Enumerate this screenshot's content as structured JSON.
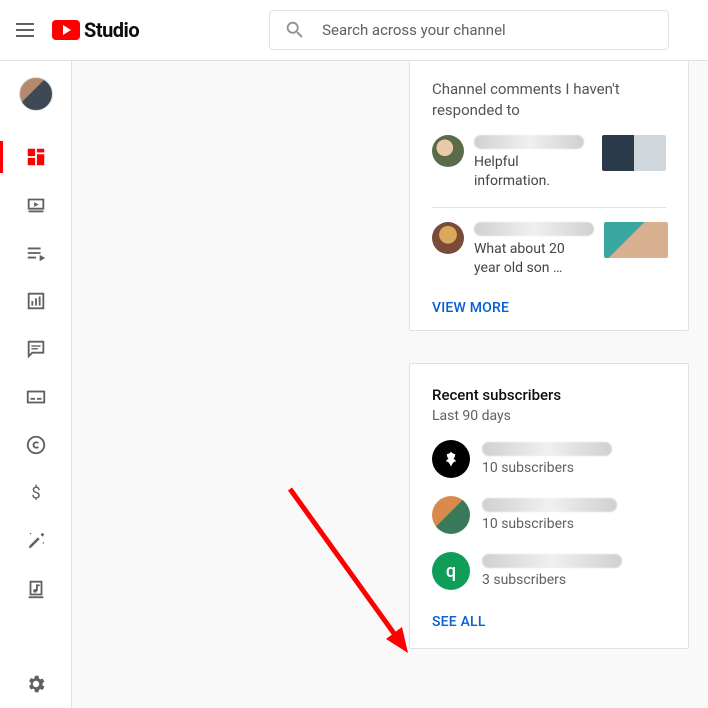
{
  "header": {
    "brand": "Studio",
    "search_placeholder": "Search across your channel"
  },
  "comments_card": {
    "title": "Channel comments I haven't responded to",
    "items": [
      {
        "body": "Helpful information."
      },
      {
        "body": "What about 20 year old son …"
      }
    ],
    "view_more": "VIEW MORE"
  },
  "subs_card": {
    "title": "Recent subscribers",
    "subtitle": "Last 90 days",
    "items": [
      {
        "count": "10 subscribers"
      },
      {
        "count": "10 subscribers"
      },
      {
        "count": "3 subscribers"
      }
    ],
    "see_all": "SEE ALL"
  }
}
